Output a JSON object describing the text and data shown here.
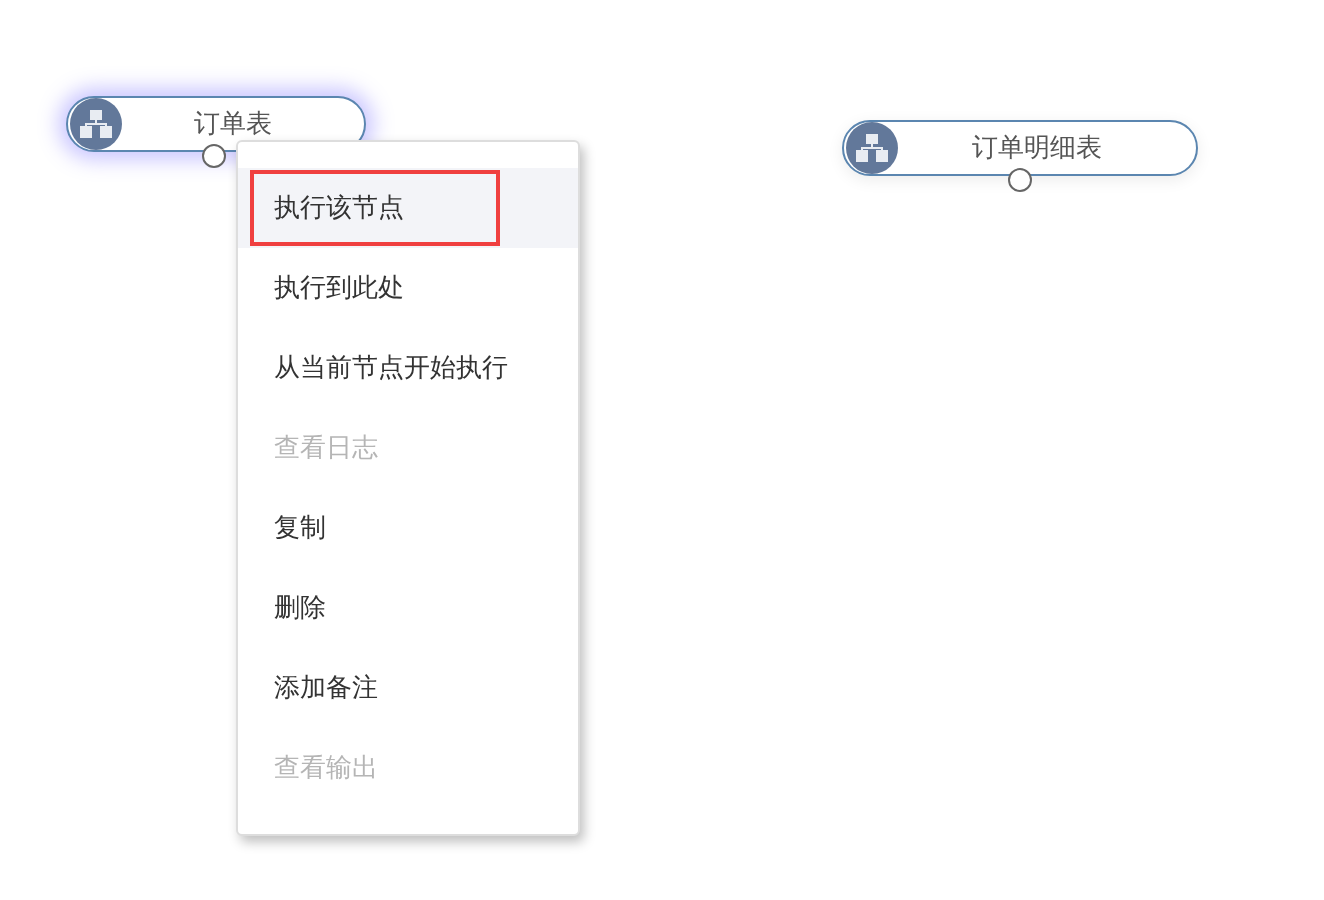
{
  "nodes": [
    {
      "label": "订单表",
      "selected": true
    },
    {
      "label": "订单明细表",
      "selected": false
    }
  ],
  "context_menu": {
    "items": [
      {
        "label": "执行该节点",
        "disabled": false,
        "hovered": true,
        "outlined": true
      },
      {
        "label": "执行到此处",
        "disabled": false,
        "hovered": false,
        "outlined": false
      },
      {
        "label": "从当前节点开始执行",
        "disabled": false,
        "hovered": false,
        "outlined": false
      },
      {
        "label": "查看日志",
        "disabled": true,
        "hovered": false,
        "outlined": false
      },
      {
        "label": "复制",
        "disabled": false,
        "hovered": false,
        "outlined": false
      },
      {
        "label": "删除",
        "disabled": false,
        "hovered": false,
        "outlined": false
      },
      {
        "label": "添加备注",
        "disabled": false,
        "hovered": false,
        "outlined": false
      },
      {
        "label": "查看输出",
        "disabled": true,
        "hovered": false,
        "outlined": false
      }
    ]
  }
}
